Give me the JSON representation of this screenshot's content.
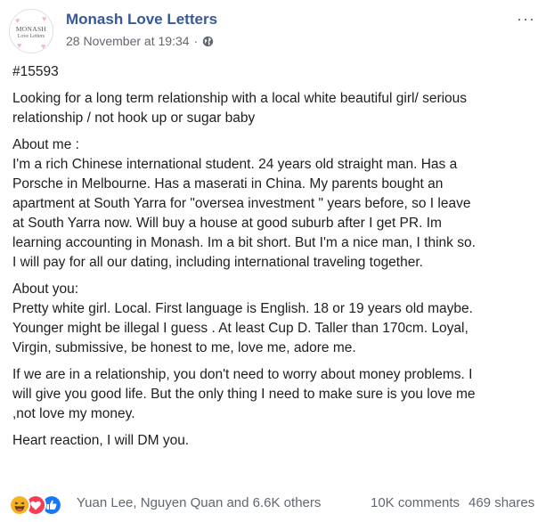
{
  "header": {
    "page_name": "Monash Love Letters",
    "avatar_text_line1": "MONASH",
    "avatar_text_line2": "Love Letters",
    "timestamp": "28 November at 19:34",
    "separator": "·",
    "privacy_icon": "globe-icon",
    "more_icon": "more-options-icon",
    "more_label": "···"
  },
  "post": {
    "tag": "#15593",
    "intro": [
      "Looking for a long term relationship with a local white beautiful girl/ serious",
      "relationship / not hook up or sugar baby"
    ],
    "about_me": [
      "About me :",
      "I'm a rich Chinese international student. 24 years old straight man. Has a",
      "Porsche in Melbourne. Has a maserati in China. My parents bought an",
      "apartment at South Yarra for \"oversea investment \" years before, so I leave",
      "at South Yarra now. Will buy a house at good suburb after I get PR. Im",
      "learning accounting in Monash. Im a bit short. But I'm a nice man, I think so.",
      "I will pay for all our dating, including international traveling together."
    ],
    "about_you": [
      "About you:",
      "Pretty white girl. Local. First language is English. 18 or 19 years old maybe.",
      "Younger might be illegal I guess . At least Cup D. Taller than 170cm. Loyal,",
      "Virgin, submissive, be honest to me, love me, adore me."
    ],
    "relationship": [
      "If we are in a relationship, you don't need to worry about money problems. I",
      "will give you good life. But the only thing I need to make sure is you love me",
      ",not love my money."
    ],
    "closing": [
      "Heart reaction, I will DM you."
    ]
  },
  "footer": {
    "reactions": [
      "haha-reaction-icon",
      "love-reaction-icon",
      "like-reaction-icon"
    ],
    "reaction_summary": "Yuan Lee, Nguyen Quan and 6.6K others",
    "comments": "10K comments",
    "shares": "469 shares"
  },
  "colors": {
    "page_name": "#385898",
    "meta_text": "#606770",
    "body_text": "#1c1e21",
    "like_blue": "#1877f2",
    "love_red": "#f33e58",
    "haha_yellow": "#f7b125"
  }
}
